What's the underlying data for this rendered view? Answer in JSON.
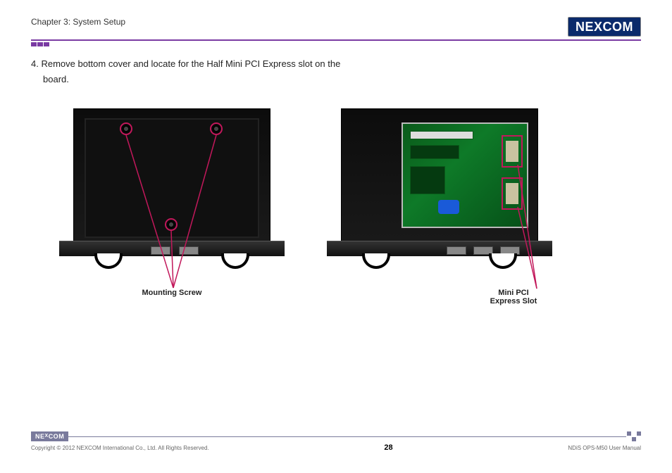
{
  "header": {
    "chapter": "Chapter 3: System Setup",
    "logo_text": "NE COM",
    "logo_x": "X"
  },
  "instruction": {
    "number": "4.",
    "text_line1": "Remove bottom cover and locate for the Half Mini PCI Express slot on the",
    "text_line2": "board."
  },
  "figure_left": {
    "label": "Mounting Screw"
  },
  "figure_right": {
    "label_line1": "Mini PCI",
    "label_line2": "Express Slot"
  },
  "footer": {
    "logo_text": "NE COM",
    "logo_x": "X",
    "copyright": "Copyright © 2012 NEXCOM International Co., Ltd. All Rights Reserved.",
    "page_number": "28",
    "manual_title": "NDiS OPS-M50 User Manual"
  },
  "colors": {
    "accent": "#7a3aa3",
    "pointer": "#c2185b",
    "brand_bg": "#0a2a6b"
  }
}
